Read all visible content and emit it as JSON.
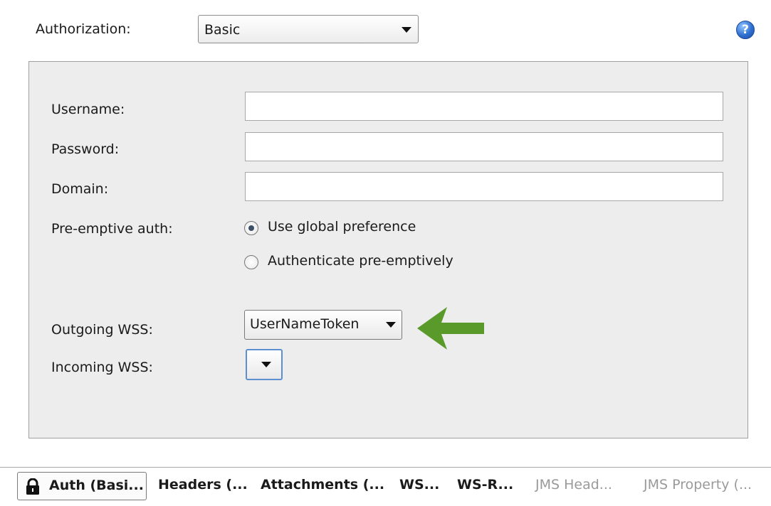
{
  "authorization": {
    "label": "Authorization:",
    "selected": "Basic"
  },
  "help": {
    "glyph": "?"
  },
  "form": {
    "username_label": "Username:",
    "username_value": "",
    "password_label": "Password:",
    "password_value": "",
    "domain_label": "Domain:",
    "domain_value": "",
    "preemptive_label": "Pre-emptive auth:",
    "radio_options": [
      {
        "label": "Use global preference",
        "selected": true
      },
      {
        "label": "Authenticate pre-emptively",
        "selected": false
      }
    ],
    "outgoing_wss_label": "Outgoing WSS:",
    "outgoing_wss_value": "UserNameToken",
    "incoming_wss_label": "Incoming WSS:",
    "incoming_wss_value": ""
  },
  "tabs": [
    {
      "label": "Auth (Basi...",
      "active": true,
      "icon": "lock-icon"
    },
    {
      "label": "Headers (...",
      "active": false
    },
    {
      "label": "Attachments (...",
      "active": false
    },
    {
      "label": "WS...",
      "active": false
    },
    {
      "label": "WS-R...",
      "active": false
    },
    {
      "label": "JMS Head...",
      "active": false,
      "disabled": true
    },
    {
      "label": "JMS Property (...",
      "active": false,
      "disabled": true
    }
  ],
  "colors": {
    "panel_bg": "#ededed",
    "annotation_arrow": "#5a9a2a",
    "help_icon": "#2f6fd0"
  }
}
